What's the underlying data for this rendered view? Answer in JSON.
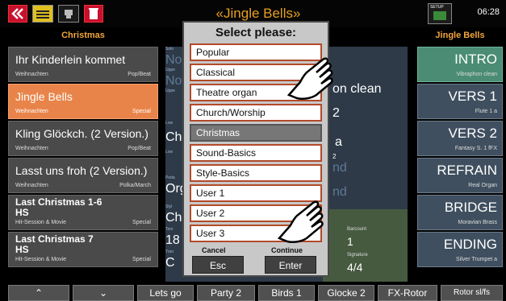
{
  "top": {
    "song_title": "«Jingle Bells»",
    "clock": "06:28",
    "setup_label": "SETUP"
  },
  "headers": {
    "left": "Christmas",
    "right": "Jingle Bells"
  },
  "songs": [
    {
      "title": "Ihr Kinderlein kommet",
      "sub1": "Weihnachten",
      "sub2": "Pop/Beat"
    },
    {
      "title": "Jingle Bells",
      "sub1": "Weihnachten",
      "sub2": "Special"
    },
    {
      "title": "Kling Glöckch. (2 Version.)",
      "sub1": "Weihnachten",
      "sub2": "Pop/Beat"
    },
    {
      "title": "Lasst uns froh (2 Version.)",
      "sub1": "Weihnachten",
      "sub2": "Polka/March"
    },
    {
      "title": "Last Christmas 1-6",
      "title2": "HS",
      "sub1": "Hit-Session & Movie",
      "sub2": "Special"
    },
    {
      "title": "Last Christmas 7",
      "title2": "HS",
      "sub1": "Hit-Session & Movie",
      "sub2": "Special"
    }
  ],
  "mid": {
    "solo": "Solo",
    "upper1": "Uppe",
    "upper2": "Uppe",
    "lower1": "Low",
    "lower2": "Low",
    "pedal": "Peda",
    "style": "Styl",
    "tempo": "Tem",
    "transpose": "Tran",
    "v_no1": "No",
    "v_no2": "No",
    "v_ch": "Ch",
    "v_org": "Org",
    "v_ch2": "Ch",
    "v_18": "18",
    "v_c": "C",
    "v_onclean": "on clean",
    "v_2": "2",
    "v_a": "a",
    "v_2b": "2",
    "v_nd": "nd",
    "v_nd2": "nd",
    "barcount_label": "Barcount",
    "barcount": "1",
    "signature_label": "Signature",
    "signature": "4/4"
  },
  "right_buttons": [
    {
      "big": "INTRO",
      "small": "Vibraphon clean"
    },
    {
      "big": "VERS 1",
      "small": "Flute 1     a"
    },
    {
      "big": "VERS 2",
      "small": "Fantasy S. 1 fFX"
    },
    {
      "big": "REFRAIN",
      "small": "Real Organ"
    },
    {
      "big": "BRIDGE",
      "small": "Moravian Brass"
    },
    {
      "big": "ENDING",
      "small": "Silver Trumpet a"
    }
  ],
  "dialog": {
    "title": "Select please:",
    "options": [
      "Popular",
      "Classical",
      "Theatre organ",
      "Church/Worship",
      "Christmas",
      "Sound-Basics",
      "Style-Basics",
      "User 1",
      "User 2",
      "User 3"
    ],
    "cancel_label": "Cancel",
    "continue_label": "Continue",
    "esc": "Esc",
    "enter": "Enter"
  },
  "bottom": {
    "up": "⌃",
    "down": "⌄",
    "b1": "Lets go",
    "b2": "Party 2",
    "b3": "Birds 1",
    "b4": "Glocke 2",
    "b5": "FX-Rotor",
    "b6": "Rotor sl/fs"
  },
  "colors": {
    "accent_orange": "#e8844a",
    "accent_green": "#4a8c74",
    "dialog_border": "#b24a2a"
  }
}
